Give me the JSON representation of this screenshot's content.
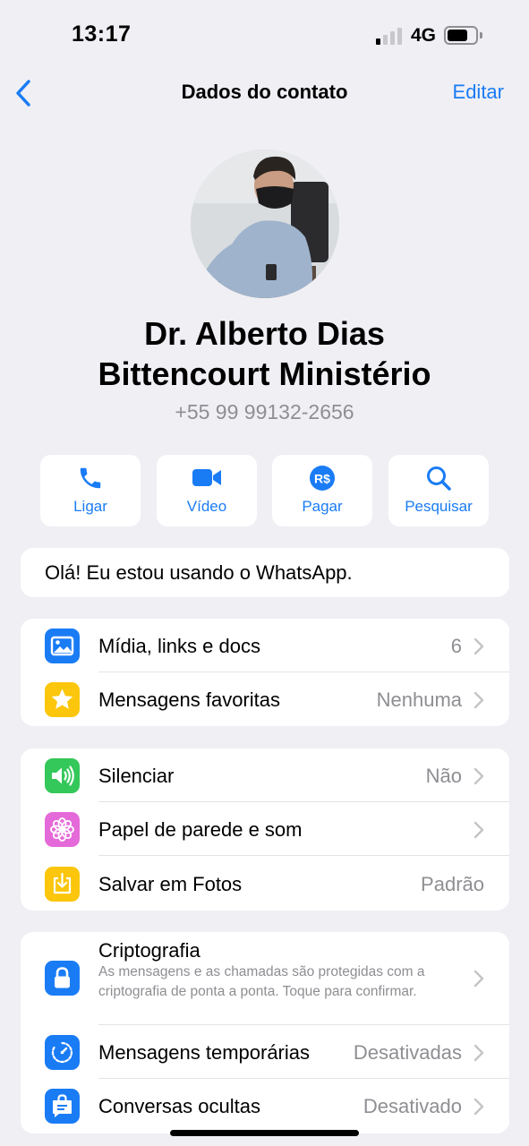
{
  "status_bar": {
    "time": "13:17",
    "network": "4G"
  },
  "nav": {
    "title": "Dados do contato",
    "edit_label": "Editar"
  },
  "contact": {
    "name_line1": "Dr. Alberto Dias",
    "name_line2": "Bittencourt Ministério",
    "phone": "+55 99 99132-2656"
  },
  "actions": [
    {
      "label": "Ligar",
      "icon": "phone-icon"
    },
    {
      "label": "Vídeo",
      "icon": "video-camera-icon"
    },
    {
      "label": "Pagar",
      "icon": "real-currency-icon",
      "icon_text": "R$"
    },
    {
      "label": "Pesquisar",
      "icon": "search-icon"
    }
  ],
  "about": {
    "text": "Olá! Eu estou usando o WhatsApp."
  },
  "group1": [
    {
      "label": "Mídia, links e docs",
      "value": "6",
      "icon": "photo-icon",
      "color": "#1a7cf5"
    },
    {
      "label": "Mensagens favoritas",
      "value": "Nenhuma",
      "icon": "star-icon",
      "color": "#fbc60b"
    }
  ],
  "group2": [
    {
      "label": "Silenciar",
      "value": "Não",
      "icon": "speaker-icon",
      "color": "#34c759"
    },
    {
      "label": "Papel de parede e som",
      "value": "",
      "icon": "flower-icon",
      "color": "#e56ad9"
    },
    {
      "label": "Salvar em Fotos",
      "value": "Padrão",
      "icon": "download-icon",
      "color": "#fbc60b"
    }
  ],
  "group3": [
    {
      "label": "Criptografia",
      "description": "As mensagens e as chamadas são protegidas com a criptografia de ponta a ponta. Toque para confirmar.",
      "icon": "lock-icon",
      "color": "#1a7cf5"
    },
    {
      "label": "Mensagens temporárias",
      "value": "Desativadas",
      "icon": "timer-icon",
      "color": "#1a7cf5"
    },
    {
      "label": "Conversas ocultas",
      "value": "Desativado",
      "icon": "locked-chat-icon",
      "color": "#1a7cf5"
    }
  ],
  "colors": {
    "accent": "#1a7cf5",
    "background": "#efeff4",
    "secondary_text": "#8e8e93"
  }
}
